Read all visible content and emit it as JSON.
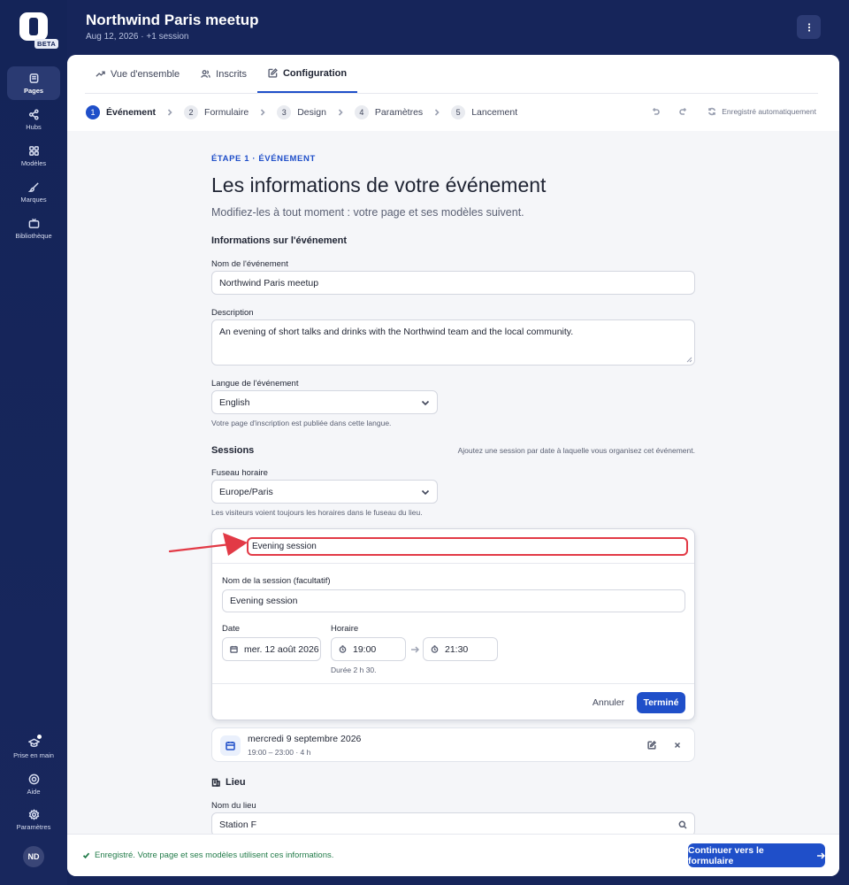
{
  "rail": {
    "badge": "BETA",
    "items": [
      {
        "label": "Pages",
        "icon": "pages-icon",
        "active": true
      },
      {
        "label": "Hubs",
        "icon": "share-icon",
        "active": false
      },
      {
        "label": "Modèles",
        "icon": "grid-icon",
        "active": false
      },
      {
        "label": "Marques",
        "icon": "brush-icon",
        "active": false
      },
      {
        "label": "Bibliothèque",
        "icon": "tv-icon",
        "active": false
      }
    ],
    "bottom_items": [
      {
        "label": "Prise en main",
        "icon": "graduation-cap-icon"
      },
      {
        "label": "Aide",
        "icon": "lifebuoy-icon"
      },
      {
        "label": "Paramètres",
        "icon": "gear-icon"
      }
    ],
    "avatar_initials": "ND"
  },
  "header": {
    "title": "Northwind Paris meetup",
    "subtitle": "Aug 12, 2026 · +1 session"
  },
  "tabs": [
    {
      "label": "Vue d'ensemble",
      "icon": "trend-icon",
      "active": false
    },
    {
      "label": "Inscrits",
      "icon": "users-icon",
      "active": false
    },
    {
      "label": "Configuration",
      "icon": "edit-icon",
      "active": true
    }
  ],
  "steps": [
    {
      "num": "1",
      "label": "Événement",
      "active": true
    },
    {
      "num": "2",
      "label": "Formulaire",
      "active": false
    },
    {
      "num": "3",
      "label": "Design",
      "active": false
    },
    {
      "num": "4",
      "label": "Paramètres",
      "active": false
    },
    {
      "num": "5",
      "label": "Lancement",
      "active": false
    }
  ],
  "autosave": "Enregistré automatiquement",
  "form": {
    "eyebrow": "ÉTAPE 1 · ÉVÉNEMENT",
    "heading": "Les informations de votre événement",
    "lede": "Modifiez-les à tout moment : votre page et ses modèles suivent.",
    "event_section": "Informations sur l'événement",
    "name_label": "Nom de l'événement",
    "name_value": "Northwind Paris meetup",
    "desc_label": "Description",
    "desc_value": "An evening of short talks and drinks with the Northwind team and the local community.",
    "lang_label": "Langue de l'événement",
    "lang_value": "English",
    "lang_hint": "Votre page d'inscription est publiée dans cette langue.",
    "sessions_title": "Sessions",
    "sessions_hint": "Ajoutez une session par date à laquelle vous organisez cet événement.",
    "tz_label": "Fuseau horaire",
    "tz_value": "Europe/Paris",
    "tz_hint": "Les visiteurs voient toujours les horaires dans le fuseau du lieu.",
    "lieu_title": "Lieu",
    "venue_label": "Nom du lieu",
    "venue_value": "Station F"
  },
  "session_edit": {
    "header_name": "Evening session",
    "name_label": "Nom de la session (facultatif)",
    "name_value": "Evening session",
    "date_label": "Date",
    "date_value": "mer. 12 août 2026",
    "time_label": "Horaire",
    "start": "19:00",
    "end": "21:30",
    "duration": "Durée 2 h 30.",
    "cancel": "Annuler",
    "done": "Terminé"
  },
  "session_row": {
    "title": "mercredi 9 septembre 2026",
    "subtitle": "19:00 – 23:00 · 4 h"
  },
  "footer": {
    "saved": "Enregistré. Votre page et ses modèles utilisent ces informations.",
    "continue": "Continuer vers le formulaire"
  },
  "colors": {
    "accent": "#1f4fc9",
    "rail_bg": "#142458",
    "highlight": "#e23a46",
    "success": "#237c4a"
  }
}
